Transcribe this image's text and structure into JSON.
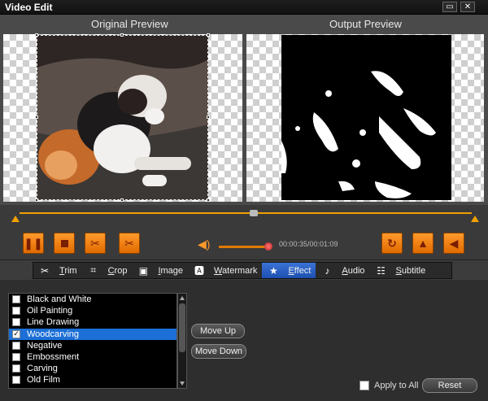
{
  "window": {
    "title": "Video Edit",
    "minimize": "▭",
    "close": "✕"
  },
  "preview": {
    "original_label": "Original Preview",
    "output_label": "Output Preview"
  },
  "playback": {
    "time": "00:00:35/00:01:09",
    "volume_fraction": 0.93
  },
  "controls": {
    "pause_icon": "pause-icon",
    "stop_icon": "stop-icon",
    "cut_icon": "scissors-icon",
    "split_icon": "split-scissors-icon",
    "rotate_icon": "rotate-icon",
    "flip_v_icon": "flip-vertical-icon",
    "flip_h_icon": "flip-horizontal-icon"
  },
  "tabs": [
    {
      "label": "Trim",
      "icon": "scissors-icon",
      "key": "T"
    },
    {
      "label": "Crop",
      "icon": "crop-icon",
      "key": "C"
    },
    {
      "label": "Image",
      "icon": "image-icon",
      "key": "I"
    },
    {
      "label": "Watermark",
      "icon": "watermark-icon",
      "key": "W"
    },
    {
      "label": "Effect",
      "icon": "star-icon",
      "key": "E",
      "active": true
    },
    {
      "label": "Audio",
      "icon": "music-note-icon",
      "key": "A"
    },
    {
      "label": "Subtitle",
      "icon": "subtitle-icon",
      "key": "S"
    }
  ],
  "effects": [
    {
      "label": "Black and White",
      "checked": false
    },
    {
      "label": "Oil Painting",
      "checked": false
    },
    {
      "label": "Line Drawing",
      "checked": false
    },
    {
      "label": "Woodcarving",
      "checked": true
    },
    {
      "label": "Negative",
      "checked": false
    },
    {
      "label": "Embossment",
      "checked": false
    },
    {
      "label": "Carving",
      "checked": false
    },
    {
      "label": "Old Film",
      "checked": false
    }
  ],
  "buttons": {
    "move_up": "Move Up",
    "move_down": "Move Down",
    "reset": "Reset"
  },
  "apply_to_all": {
    "label": "Apply to All",
    "checked": false
  },
  "colors": {
    "accent": "#f0a000",
    "selection": "#1c6fd6",
    "active_tab": "#2f63c8"
  }
}
